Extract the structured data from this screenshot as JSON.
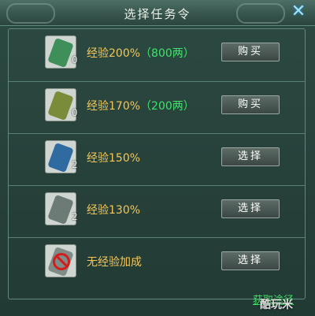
{
  "dialog": {
    "title": "选择任务令",
    "close_glyph": "✕"
  },
  "rows": [
    {
      "icon": "green-token-icon",
      "count": "0",
      "label": "经验200%",
      "cost": "（800两）",
      "button": "购买"
    },
    {
      "icon": "olive-token-icon",
      "count": "0",
      "label": "经验170%",
      "cost": "（200两）",
      "button": "购买"
    },
    {
      "icon": "blue-token-icon",
      "count": "2",
      "label": "经验150%",
      "cost": "",
      "button": "选择"
    },
    {
      "icon": "gray-token-icon",
      "count": "2",
      "label": "经验130%",
      "cost": "",
      "button": "选择"
    },
    {
      "icon": "no-bonus-icon",
      "count": "",
      "label": "无经验加成",
      "cost": "",
      "button": "选择"
    }
  ],
  "footer": {
    "link_label": "获取途径"
  },
  "watermark": "酷玩米",
  "colors": {
    "label": "#f2c65a",
    "cost": "#3fe36a",
    "link": "#3fe36a",
    "close": "#9fe3ff"
  }
}
